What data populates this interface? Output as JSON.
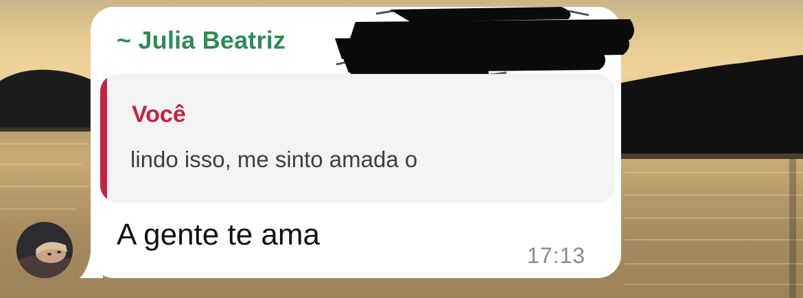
{
  "chat": {
    "sender_name": "~ Julia Beatriz",
    "quoted": {
      "author": "Você",
      "text": "lindo isso, me sinto amada o"
    },
    "message_text": "A gente te ama",
    "time": "17:13"
  },
  "colors": {
    "sender": "#2f8a55",
    "quote_accent": "#c8213f",
    "bubble": "#ffffff",
    "quote_background": "#f3f3f4",
    "timestamp": "#8a8a8e"
  },
  "icons": {
    "avatar": "profile-photo",
    "redaction": "scribble-redaction"
  }
}
